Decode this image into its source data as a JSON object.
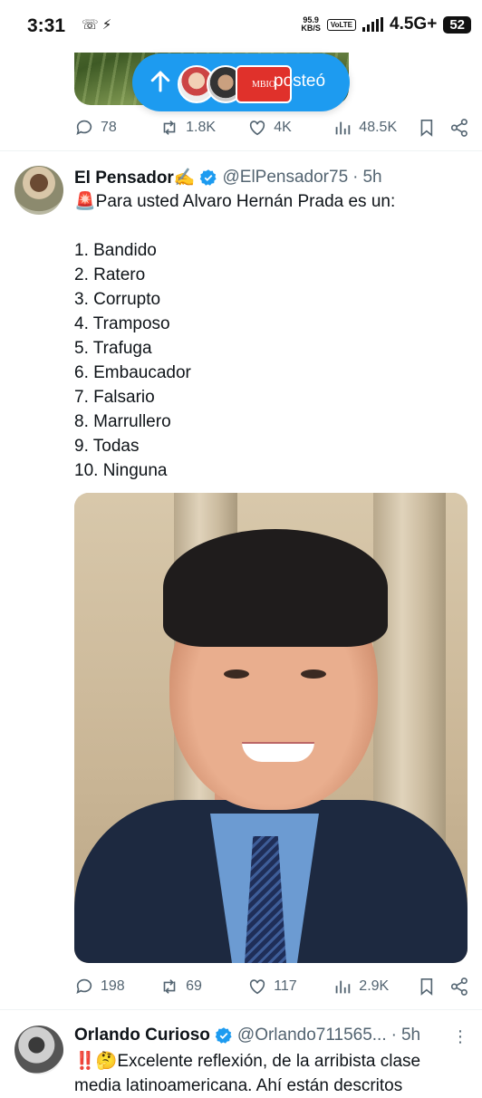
{
  "status_bar": {
    "time": "3:31",
    "left_icons": "missed-call-icon messenger-icon",
    "net_speed_value": "95.9",
    "net_speed_unit": "KB/S",
    "volte": "VoLTE",
    "network": "4.5G+",
    "battery": "52"
  },
  "toast": {
    "text": "posteó",
    "badge_text": "MBIO"
  },
  "prev_tweet": {
    "actions": {
      "reply": "78",
      "retweet": "1.8K",
      "like": "4K",
      "views": "48.5K"
    }
  },
  "tweet_pensador": {
    "name": "El Pensador✍️",
    "handle": "@ElPensador75",
    "separator": "·",
    "time": "5h",
    "text_intro": "🚨Para usted Alvaro Hernán Prada es un:",
    "options": [
      "1. Bandido",
      "2. Ratero",
      "3. Corrupto",
      "4. Tramposo",
      "5. Trafuga",
      "6. Embaucador",
      "7. Falsario",
      "8. Marrullero",
      "9. Todas",
      "10. Ninguna"
    ],
    "actions": {
      "reply": "198",
      "retweet": "69",
      "like": "117",
      "views": "2.9K"
    }
  },
  "tweet_curioso": {
    "name": "Orlando Curioso",
    "handle": "@Orlando711565...",
    "separator": "·",
    "time": "5h",
    "more": "⋮",
    "text": "‼️🤔Excelente reflexión, de la arribista clase media latinoamericana. Ahí están descritos"
  },
  "colors": {
    "accent": "#1d9bf0",
    "secondary_text": "#536471",
    "primary_text": "#0f1419"
  }
}
